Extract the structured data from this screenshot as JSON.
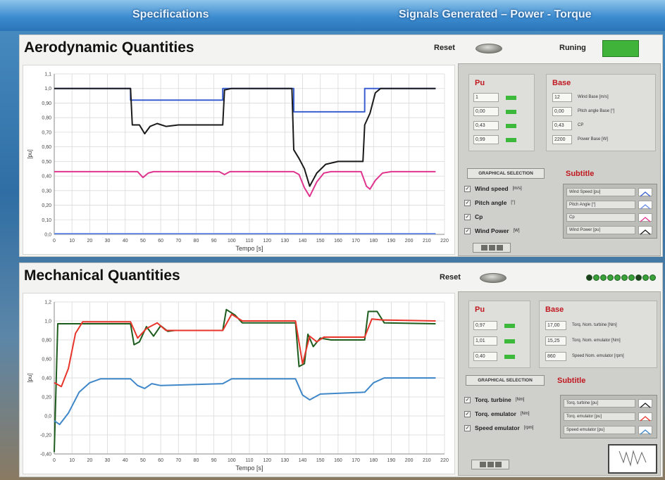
{
  "topbar": {
    "tab_specs": "Specifications",
    "tab_signals": "Signals Generated – Power - Torque"
  },
  "aero": {
    "title": "Aerodynamic Quantities",
    "reset_label": "Reset",
    "running_label": "Runing",
    "pu": {
      "title": "Pu",
      "values": [
        "1",
        "0,00",
        "0,43",
        "0,99"
      ]
    },
    "base": {
      "title": "Base",
      "values": [
        "12",
        "0,00",
        "0,43",
        "2200"
      ],
      "labels": [
        "Wind Base [m/s]",
        "Pitch angle Base [°]",
        "CP",
        "Power Base [W]"
      ]
    },
    "graphical_selection": "GRAPHICAL SELECTION",
    "subtitle": "Subtitle",
    "checks": [
      {
        "label": "Wind speed",
        "unit": "[m/s]"
      },
      {
        "label": "Pitch angle",
        "unit": "[°]"
      },
      {
        "label": "Cp",
        "unit": ""
      },
      {
        "label": "Wind Power",
        "unit": "[W]"
      }
    ],
    "legend": [
      "Wind Speed [pu]",
      "Pitch Angle [°]",
      "Cp",
      "Wind Power [pu]"
    ]
  },
  "mech": {
    "title": "Mechanical Quantities",
    "reset_label": "Reset",
    "pu": {
      "title": "Pu",
      "values": [
        "0,97",
        "1,01",
        "0,40"
      ]
    },
    "base": {
      "title": "Base",
      "values": [
        "17,00",
        "15,25",
        "860"
      ],
      "labels": [
        "Torq. Nom. turbine [Nm]",
        "Torq. Nom. emulator [Nm]",
        "Speed Nom. emulator [rpm]"
      ]
    },
    "graphical_selection": "GRAPHICAL SELECTION",
    "subtitle": "Subtitle",
    "checks": [
      {
        "label": "Torq. turbine",
        "unit": "[Nm]"
      },
      {
        "label": "Torq. emulator",
        "unit": "[Nm]"
      },
      {
        "label": "Speed emulator",
        "unit": "[rpm]"
      }
    ],
    "legend": [
      "Torq. turbine [pu]",
      "Torq. emulator [pu]",
      "Speed emulator [pu]"
    ]
  },
  "colors": {
    "black_series": "#1a1a1a",
    "blue_series": "#3a5fcf",
    "magenta_series": "#e0358f",
    "red_series": "#e8352b",
    "green_series": "#1e5c1e",
    "steel_series": "#3f87c8",
    "accent_red": "#c0181e",
    "led_green": "#3cb83a"
  },
  "chart_data": [
    {
      "type": "line",
      "xlabel": "Tempo [s]",
      "ylabel": "[pu]",
      "xlim": [
        0,
        220
      ],
      "ylim": [
        0,
        1.1
      ],
      "xticks": [
        0,
        10,
        20,
        30,
        40,
        50,
        60,
        70,
        80,
        90,
        100,
        110,
        120,
        130,
        140,
        150,
        160,
        170,
        180,
        190,
        200,
        210,
        220
      ],
      "yticks": [
        "0,0",
        "0,10",
        "0,20",
        "0,30",
        "0,40",
        "0,50",
        "0,60",
        "0,70",
        "0,80",
        "0,90",
        "1,0",
        "1,1"
      ],
      "series": [
        {
          "name": "Wind Speed [pu]",
          "color": "#3a5fcf",
          "points": [
            [
              0,
              1.0
            ],
            [
              43,
              1.0
            ],
            [
              43,
              0.92
            ],
            [
              95,
              0.92
            ],
            [
              95,
              1.0
            ],
            [
              135,
              1.0
            ],
            [
              135,
              0.84
            ],
            [
              175,
              0.84
            ],
            [
              175,
              1.0
            ],
            [
              215,
              1.0
            ]
          ]
        },
        {
          "name": "Pitch Angle [°]",
          "color": "#6a8ee6",
          "points": [
            [
              0,
              0.005
            ],
            [
              215,
              0.005
            ]
          ]
        },
        {
          "name": "Cp",
          "color": "#e0358f",
          "points": [
            [
              0,
              0.43
            ],
            [
              47,
              0.43
            ],
            [
              50,
              0.39
            ],
            [
              53,
              0.42
            ],
            [
              56,
              0.43
            ],
            [
              93,
              0.43
            ],
            [
              96,
              0.41
            ],
            [
              99,
              0.43
            ],
            [
              135,
              0.43
            ],
            [
              138,
              0.41
            ],
            [
              141,
              0.32
            ],
            [
              144,
              0.26
            ],
            [
              148,
              0.36
            ],
            [
              152,
              0.42
            ],
            [
              156,
              0.43
            ],
            [
              173,
              0.43
            ],
            [
              176,
              0.33
            ],
            [
              178,
              0.31
            ],
            [
              181,
              0.37
            ],
            [
              185,
              0.42
            ],
            [
              190,
              0.43
            ],
            [
              215,
              0.43
            ]
          ]
        },
        {
          "name": "Wind Power [pu]",
          "color": "#1a1a1a",
          "points": [
            [
              0,
              1.0
            ],
            [
              43,
              1.0
            ],
            [
              44,
              0.75
            ],
            [
              48,
              0.75
            ],
            [
              51,
              0.69
            ],
            [
              54,
              0.74
            ],
            [
              58,
              0.76
            ],
            [
              63,
              0.74
            ],
            [
              70,
              0.75
            ],
            [
              95,
              0.75
            ],
            [
              96,
              0.99
            ],
            [
              100,
              1.0
            ],
            [
              134,
              1.0
            ],
            [
              135,
              0.58
            ],
            [
              138,
              0.52
            ],
            [
              141,
              0.45
            ],
            [
              144,
              0.33
            ],
            [
              148,
              0.42
            ],
            [
              153,
              0.48
            ],
            [
              160,
              0.5
            ],
            [
              174,
              0.5
            ],
            [
              175,
              0.75
            ],
            [
              178,
              0.83
            ],
            [
              181,
              0.97
            ],
            [
              184,
              1.0
            ],
            [
              215,
              1.0
            ]
          ]
        }
      ]
    },
    {
      "type": "line",
      "xlabel": "Tempo [s]",
      "ylabel": "[pu]",
      "xlim": [
        0,
        220
      ],
      "ylim": [
        -0.4,
        1.2
      ],
      "xticks": [
        0,
        10,
        20,
        30,
        40,
        50,
        60,
        70,
        80,
        90,
        100,
        110,
        120,
        130,
        140,
        150,
        160,
        170,
        180,
        190,
        200,
        210,
        220
      ],
      "yticks": [
        "-0,40",
        "-0,20",
        "0,0",
        "0,20",
        "0,40",
        "0,60",
        "0,80",
        "1,0",
        "1,2"
      ],
      "series": [
        {
          "name": "Torq. turbine [pu]",
          "color": "#1e5c1e",
          "points": [
            [
              0,
              -0.38
            ],
            [
              2,
              0.97
            ],
            [
              43,
              0.97
            ],
            [
              45,
              0.75
            ],
            [
              48,
              0.78
            ],
            [
              52,
              0.94
            ],
            [
              56,
              0.84
            ],
            [
              60,
              0.95
            ],
            [
              64,
              0.89
            ],
            [
              68,
              0.9
            ],
            [
              95,
              0.9
            ],
            [
              97,
              1.12
            ],
            [
              102,
              1.06
            ],
            [
              106,
              0.98
            ],
            [
              136,
              0.98
            ],
            [
              138,
              0.52
            ],
            [
              141,
              0.55
            ],
            [
              143,
              0.86
            ],
            [
              146,
              0.73
            ],
            [
              150,
              0.82
            ],
            [
              156,
              0.8
            ],
            [
              175,
              0.8
            ],
            [
              177,
              1.1
            ],
            [
              182,
              1.1
            ],
            [
              186,
              0.98
            ],
            [
              215,
              0.97
            ]
          ]
        },
        {
          "name": "Torq. emulator [pu]",
          "color": "#e8352b",
          "points": [
            [
              0,
              0.35
            ],
            [
              4,
              0.31
            ],
            [
              8,
              0.5
            ],
            [
              12,
              0.87
            ],
            [
              16,
              0.99
            ],
            [
              43,
              0.99
            ],
            [
              47,
              0.82
            ],
            [
              52,
              0.92
            ],
            [
              58,
              0.98
            ],
            [
              63,
              0.9
            ],
            [
              95,
              0.9
            ],
            [
              100,
              1.07
            ],
            [
              106,
              1.0
            ],
            [
              136,
              1.0
            ],
            [
              140,
              0.55
            ],
            [
              144,
              0.84
            ],
            [
              148,
              0.78
            ],
            [
              152,
              0.83
            ],
            [
              175,
              0.83
            ],
            [
              179,
              1.02
            ],
            [
              185,
              1.01
            ],
            [
              215,
              1.0
            ]
          ]
        },
        {
          "name": "Speed emulator [pu]",
          "color": "#3f87c8",
          "points": [
            [
              0,
              -0.05
            ],
            [
              3,
              -0.09
            ],
            [
              8,
              0.03
            ],
            [
              14,
              0.25
            ],
            [
              20,
              0.35
            ],
            [
              26,
              0.39
            ],
            [
              43,
              0.39
            ],
            [
              47,
              0.32
            ],
            [
              51,
              0.29
            ],
            [
              55,
              0.34
            ],
            [
              60,
              0.32
            ],
            [
              95,
              0.34
            ],
            [
              100,
              0.39
            ],
            [
              136,
              0.39
            ],
            [
              140,
              0.22
            ],
            [
              144,
              0.17
            ],
            [
              150,
              0.23
            ],
            [
              175,
              0.25
            ],
            [
              180,
              0.35
            ],
            [
              186,
              0.4
            ],
            [
              215,
              0.4
            ]
          ]
        }
      ]
    }
  ]
}
